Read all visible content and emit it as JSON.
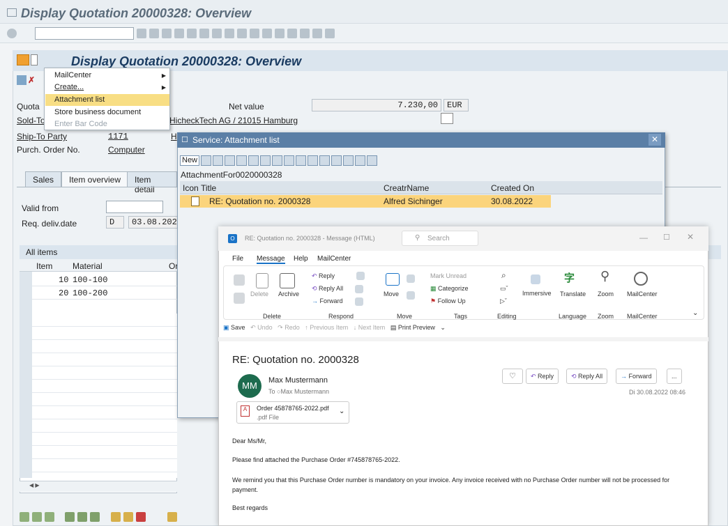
{
  "window_title": "Display Quotation 20000328: Overview",
  "screen_title": "Display Quotation 20000328: Overview",
  "context_menu": {
    "items": [
      "MailCenter",
      "Create...",
      "Attachment list",
      "Store business document",
      "Enter Bar Code"
    ]
  },
  "header": {
    "quotation_label": "Quota",
    "net_value_label": "Net value",
    "net_value": "7.230,00",
    "currency": "EUR",
    "sold_to_label": "Sold-To",
    "sold_to_value": "HicheckTech AG / 21015 Hamburg",
    "ship_to_label": "Ship-To Party",
    "ship_to_value": "1171",
    "ship_to_name_partial": "H",
    "purch_order_label": "Purch. Order No.",
    "purch_order_value": "Computer"
  },
  "tabs": [
    "Sales",
    "Item overview",
    "Item detail"
  ],
  "dates": {
    "valid_from_label": "Valid from",
    "req_deliv_label": "Req. deliv.date",
    "req_deliv_unit": "D",
    "req_deliv_value": "03.08.202"
  },
  "items_table": {
    "title": "All items",
    "columns": [
      "Item",
      "Material",
      "Or"
    ],
    "rows": [
      {
        "item": "10",
        "material": "100-100"
      },
      {
        "item": "20",
        "material": "100-200"
      }
    ]
  },
  "service_dialog": {
    "title": "Service: Attachment list",
    "new_button": "New",
    "object": "AttachmentFor0020000328",
    "columns": [
      "Icon",
      "Title",
      "CreatrName",
      "Created On"
    ],
    "rows": [
      {
        "title": "RE: Quotation no. 2000328",
        "creator": "Alfred Sichinger",
        "created_on": "30.08.2022"
      }
    ]
  },
  "outlook": {
    "window_title": "RE: Quotation no. 2000328 - Message (HTML)",
    "search_placeholder": "Search",
    "menu": [
      "File",
      "Message",
      "Help",
      "MailCenter"
    ],
    "ribbon": {
      "delete_group": {
        "buttons": [
          "Delete",
          "Archive"
        ],
        "label": "Delete"
      },
      "respond_group": {
        "buttons": [
          "Reply",
          "Reply All",
          "Forward"
        ],
        "label": "Respond"
      },
      "move_group": {
        "buttons": [
          "Move"
        ],
        "label": "Move"
      },
      "tags_group": {
        "buttons": [
          "Mark Unread",
          "Categorize",
          "Follow Up"
        ],
        "label": "Tags"
      },
      "editing_label": "Editing",
      "immersive": "Immersive",
      "language_group": {
        "buttons": [
          "Translate"
        ],
        "label": "Language"
      },
      "zoom_group": {
        "buttons": [
          "Zoom"
        ],
        "label": "Zoom"
      },
      "mailcenter_group": {
        "buttons": [
          "MailCenter"
        ],
        "label": "MailCenter"
      }
    },
    "quick_access": [
      "Save",
      "Undo",
      "Redo",
      "Previous Item",
      "Next Item",
      "Print Preview"
    ],
    "subject": "RE: Quotation no. 2000328",
    "sender": "Max Mustermann",
    "avatar": "MM",
    "to_label": "To",
    "to_name": "Max Mustermann",
    "date": "Di 30.08.2022 08:46",
    "actions": [
      "Reply",
      "Reply All",
      "Forward",
      "..."
    ],
    "attachment": {
      "name": "Order 45878765-2022.pdf",
      "type": ".pdf File"
    },
    "body": [
      "Dear Ms/Mr,",
      "Please find attached the Purchase Order #745878765-2022.",
      "We remind you that this Purchase Order number is mandatory on your invoice. Any invoice received with no Purchase Order number will not be processed for payment.",
      "Best regards"
    ]
  }
}
